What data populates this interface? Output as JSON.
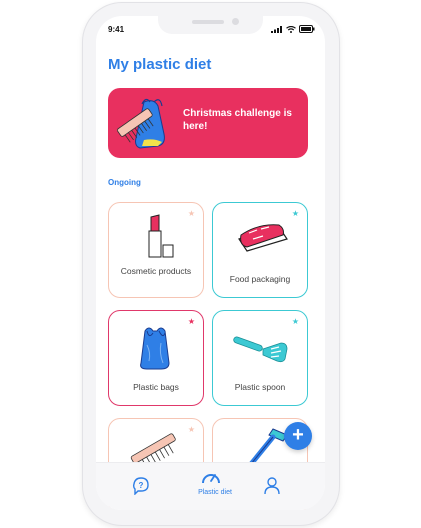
{
  "status_bar": {
    "time": "9:41"
  },
  "header": {
    "title": "My plastic diet"
  },
  "banner": {
    "text": "Christmas challenge is here!"
  },
  "section": {
    "label": "Ongoing"
  },
  "cards": [
    {
      "label": "Cosmetic products",
      "star_color": "#f6c5b4",
      "border_color": "#f6c5b4"
    },
    {
      "label": "Food packaging",
      "star_color": "#3cc9d3",
      "border_color": "#3cc9d3"
    },
    {
      "label": "Plastic bags",
      "star_color": "#e8305f",
      "border_color": "#e0386a"
    },
    {
      "label": "Plastic spoon",
      "star_color": "#3cc9d3",
      "border_color": "#3cc9d3"
    }
  ],
  "tabbar": {
    "active_label": "Plastic diet"
  },
  "colors": {
    "accent": "#2f7fe6",
    "pink": "#e8305f",
    "teal": "#3cc9d3",
    "peach": "#f6c5b4"
  }
}
